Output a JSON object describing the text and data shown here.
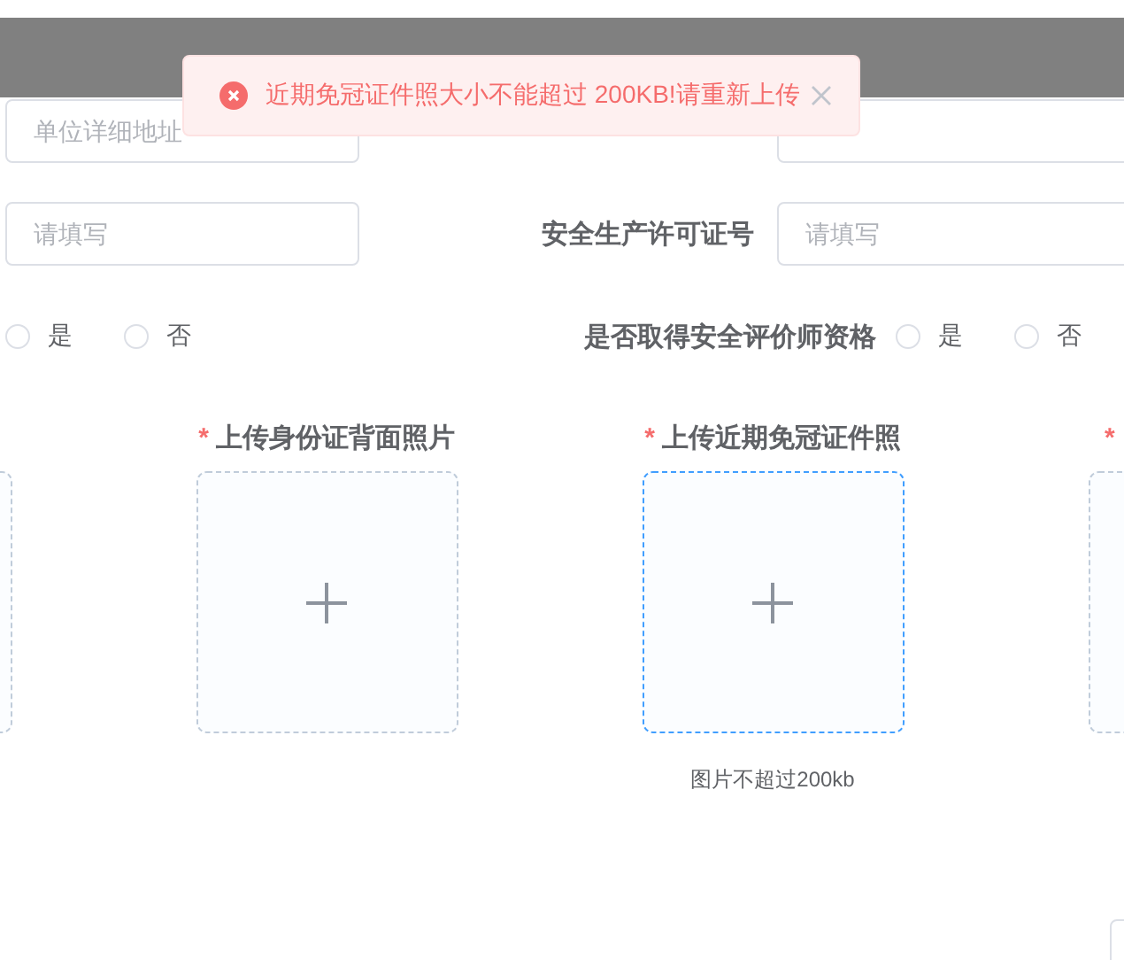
{
  "toast": {
    "kind": "error",
    "message": "近期免冠证件照大小不能超过 200KB!请重新上传"
  },
  "address_field": {
    "placeholder": "单位详细地址"
  },
  "row2": {
    "left_field": {
      "placeholder": "请填写"
    },
    "label": "安全生产许可证号",
    "right_field": {
      "placeholder": "请填写"
    }
  },
  "row3": {
    "left_radios": [
      {
        "label": "是",
        "selected": false
      },
      {
        "label": "否",
        "selected": false
      }
    ],
    "label": "是否取得安全评价师资格",
    "right_radios": [
      {
        "label": "是",
        "selected": false
      },
      {
        "label": "否",
        "selected": false
      }
    ]
  },
  "uploads": [
    {
      "focused": false
    },
    {
      "label": "上传身份证背面照片",
      "required_mark": "*",
      "focused": false
    },
    {
      "label": "上传近期免冠证件照",
      "required_mark": "*",
      "focused": true,
      "hint": "图片不超过200kb"
    },
    {
      "required_mark": "*",
      "focused": false
    }
  ]
}
